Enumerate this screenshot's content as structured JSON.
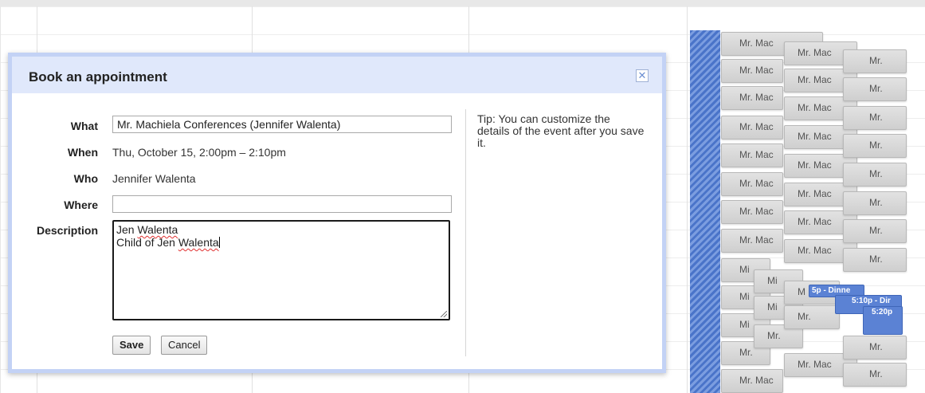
{
  "dialog": {
    "title": "Book an appointment",
    "close_glyph": "✕",
    "what_label": "What",
    "what_value": "Mr. Machiela Conferences (Jennifer Walenta)",
    "when_label": "When",
    "when_value": "Thu, October 15, 2:00pm – 2:10pm",
    "who_label": "Who",
    "who_value": "Jennifer Walenta",
    "where_label": "Where",
    "where_value": "",
    "description_label": "Description",
    "description_line1_a": "Jen ",
    "description_line1_b": "Walenta",
    "description_line2_a": "Child of Jen ",
    "description_line2_b": "Walenta",
    "save_label": "Save",
    "cancel_label": "Cancel",
    "tip_bold": "Tip",
    "tip_text": ": You can customize the details of the event after you save it."
  },
  "calendar": {
    "slot_label": "Mr. Mac",
    "slot_label_short": "Mr.",
    "slot_label_min": "Mi",
    "slot_label_mid": "M",
    "event_1": "5p - Dinne",
    "event_2": "5:10p - Dir",
    "event_3": "5:20p",
    "blocked_color": "#4a74c9",
    "event_color": "#5b82d4"
  }
}
